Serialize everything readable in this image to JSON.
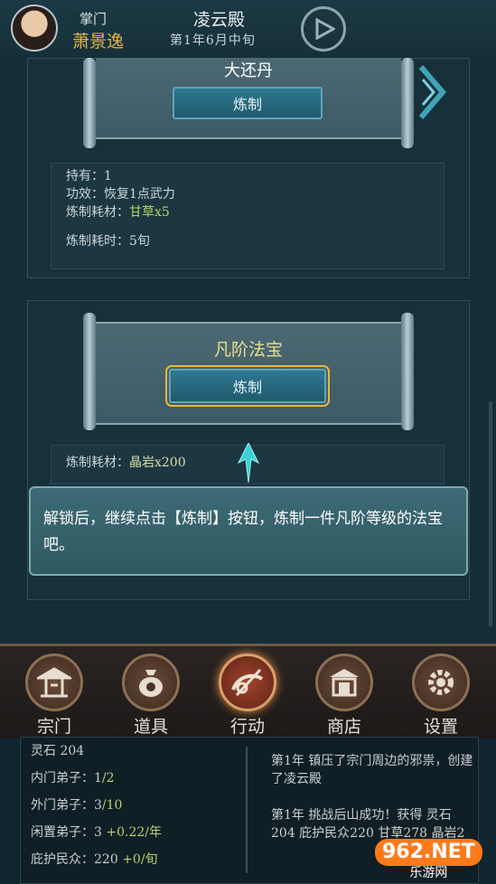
{
  "header": {
    "role": "掌门",
    "player_name": "萧景逸",
    "sect_name": "凌云殿",
    "date": "第1年6月中旬"
  },
  "item1": {
    "name": "大还丹",
    "button": "炼制",
    "holding": "持有：1",
    "effect": "功效：恢复1点武力",
    "material_label": "炼制耗材：",
    "material_value": "甘草x5",
    "time": "炼制耗时：5旬"
  },
  "item2": {
    "name": "凡阶法宝",
    "button": "炼制",
    "material_label": "炼制耗材：",
    "material_value": "晶岩x200"
  },
  "dialog": {
    "text": "解锁后，继续点击【炼制】按钮，炼制一件凡阶等级的法宝吧。"
  },
  "nav": [
    {
      "label": "宗门"
    },
    {
      "label": "道具"
    },
    {
      "label": "行动"
    },
    {
      "label": "商店"
    },
    {
      "label": "设置"
    }
  ],
  "stats": {
    "spirit_stone": "灵石 204",
    "inner_label": "内门弟子：",
    "inner_value": "1",
    "inner_max": "/2",
    "outer_label": "外门弟子：",
    "outer_value": "3",
    "outer_max": "/10",
    "idle_label": "闲置弟子：",
    "idle_value": "3",
    "idle_rate": "+0.22/年",
    "protect_label": "庇护民众：",
    "protect_value": "220",
    "protect_rate": "+0/旬"
  },
  "log": {
    "entry1": "第1年 镇压了宗门周边的邪祟，创建了凌云殿",
    "entry2": "第1年 挑战后山成功！获得 灵石204 庇护民众220 甘草278 晶岩2"
  },
  "watermark": {
    "brand": "962.NET",
    "sub": "乐游网"
  },
  "colors": {
    "accent_gold": "#e6b443",
    "accent_green": "#b6d36c",
    "button_blue": "#2f7890"
  }
}
